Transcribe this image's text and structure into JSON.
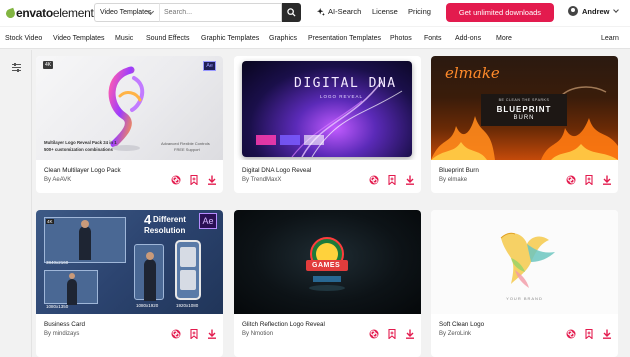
{
  "brand": {
    "name_bold": "envato",
    "name_light": "elements",
    "accent": "#82b541"
  },
  "search": {
    "category": "Video Templates",
    "placeholder": "Search..."
  },
  "top_links": {
    "ai_search": "AI-Search",
    "license": "License",
    "pricing": "Pricing"
  },
  "cta": {
    "label": "Get unlimited downloads",
    "color": "#e31b4e"
  },
  "user": {
    "name": "Andrew"
  },
  "nav": {
    "items": [
      "Stock Video",
      "Video Templates",
      "Music",
      "Sound Effects",
      "Graphic Templates",
      "Graphics",
      "Presentation Templates",
      "Photos",
      "Fonts",
      "Add-ons",
      "More"
    ],
    "learn": "Learn"
  },
  "cards": [
    {
      "title": "Clean Multilayer Logo Pack",
      "by_prefix": "By",
      "author": "AeAVK",
      "thumb": {
        "badge_left": "4K",
        "badge_right": "Ae",
        "caption_line1": "Multilayer Logo Reveal Pack 24 in 1",
        "caption_line2": "500+ customization combinations",
        "caption_right1": "Advanced Flexible Controls",
        "caption_right2": "FREE Support"
      }
    },
    {
      "title": "Digital DNA Logo Reveal",
      "by_prefix": "By",
      "author": "TrendMaxX",
      "thumb": {
        "heading": "DIGITAL DNA",
        "sub": "LOGO REVEAL"
      }
    },
    {
      "title": "Blueprint Burn",
      "by_prefix": "By",
      "author": "elmake",
      "thumb": {
        "script": "elmake",
        "sub": "BE CLEAN THE SPARKS",
        "line1": "BLUEPRINT",
        "line2": "BURN"
      }
    },
    {
      "title": "Business Card",
      "by_prefix": "By",
      "author": "mindizays",
      "thumb": {
        "heading_num": "4",
        "heading_rest": "Different",
        "heading_line2": "Resolution",
        "badge": "Ae",
        "label_4k": "4K",
        "res1": "3840x2160",
        "res2": "1080x1920",
        "res3": "1080x1350",
        "res4": "1920x1080"
      }
    },
    {
      "title": "Glitch Reflection Logo Reveal",
      "by_prefix": "By",
      "author": "Nmotion",
      "thumb": {
        "logo_text": "GAMES"
      }
    },
    {
      "title": "Soft Clean Logo",
      "by_prefix": "By",
      "author": "ZeroLink",
      "thumb": {
        "caption": "YOUR BRAND"
      }
    }
  ]
}
